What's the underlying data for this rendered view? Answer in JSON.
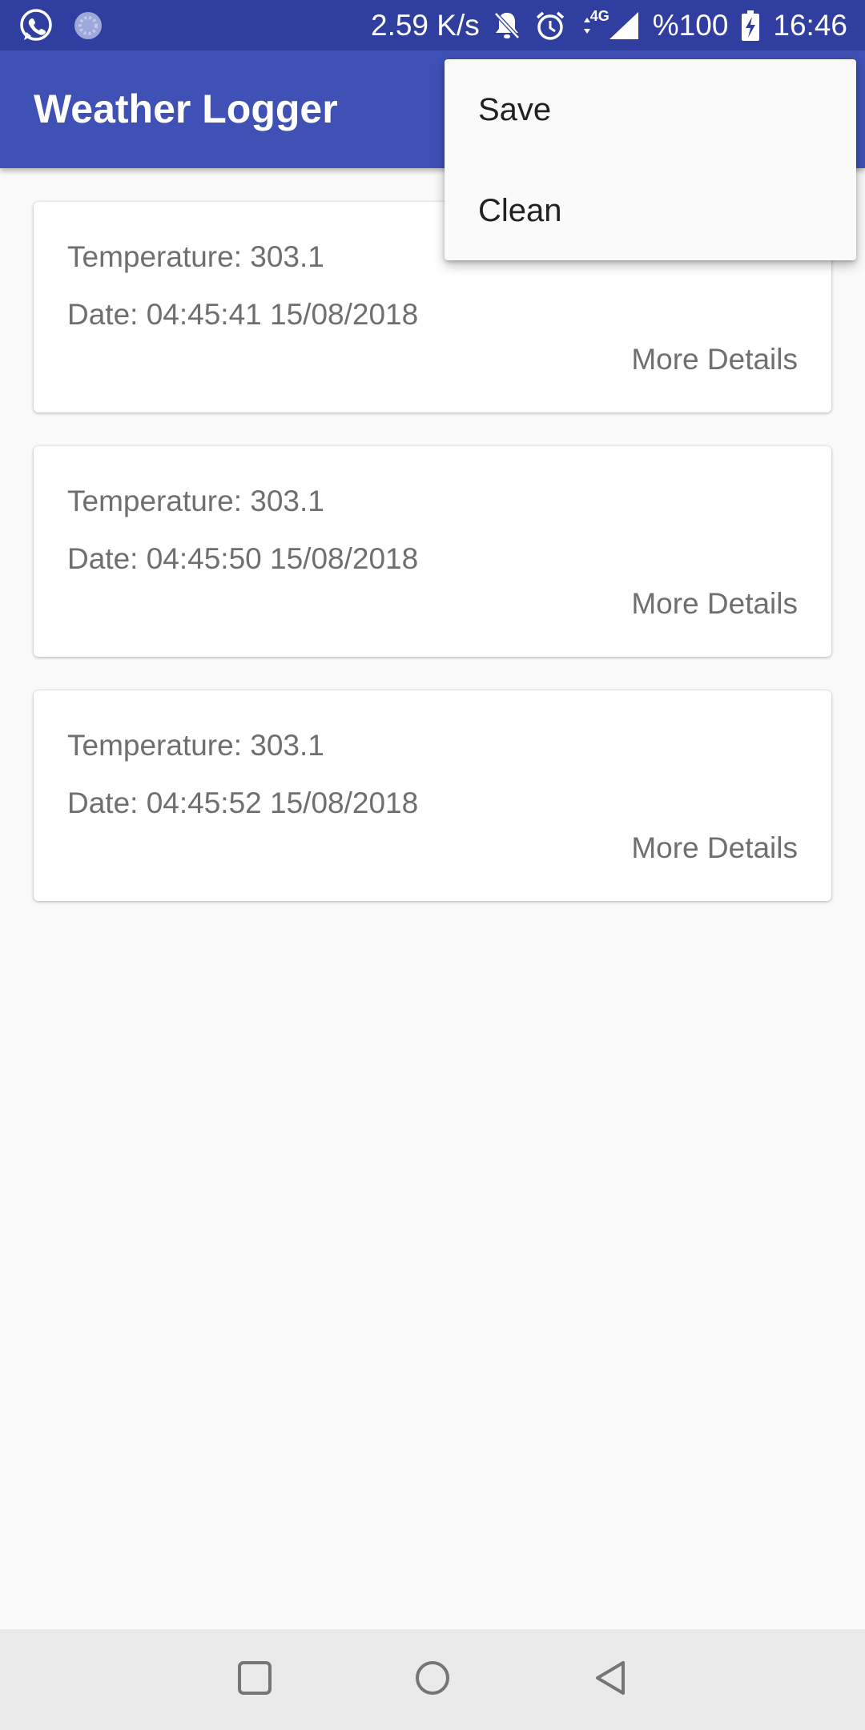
{
  "status_bar": {
    "network_speed": "2.59 K/s",
    "network_type": "4G",
    "battery": "%100",
    "time": "16:46",
    "icons": [
      "whatsapp-icon",
      "sync-icon",
      "notifications-off-icon",
      "alarm-icon",
      "data-arrows-icon",
      "signal-icon",
      "battery-charging-icon"
    ]
  },
  "app_bar": {
    "title": "Weather Logger"
  },
  "menu": {
    "items": [
      {
        "label": "Save"
      },
      {
        "label": "Clean"
      }
    ]
  },
  "records": [
    {
      "temperature": "Temperature: 303.1",
      "date": "Date: 04:45:41 15/08/2018",
      "action": "More Details"
    },
    {
      "temperature": "Temperature: 303.1",
      "date": "Date: 04:45:50 15/08/2018",
      "action": "More Details"
    },
    {
      "temperature": "Temperature: 303.1",
      "date": "Date: 04:45:52 15/08/2018",
      "action": "More Details"
    }
  ],
  "nav_bar": {
    "buttons": [
      "recents-icon",
      "home-icon",
      "back-icon"
    ]
  },
  "colors": {
    "status_bar": "#303f9f",
    "app_bar": "#3f51b5",
    "background": "#fafafa",
    "card_text": "#6f6f6f",
    "nav_bar": "#eaeaea"
  }
}
